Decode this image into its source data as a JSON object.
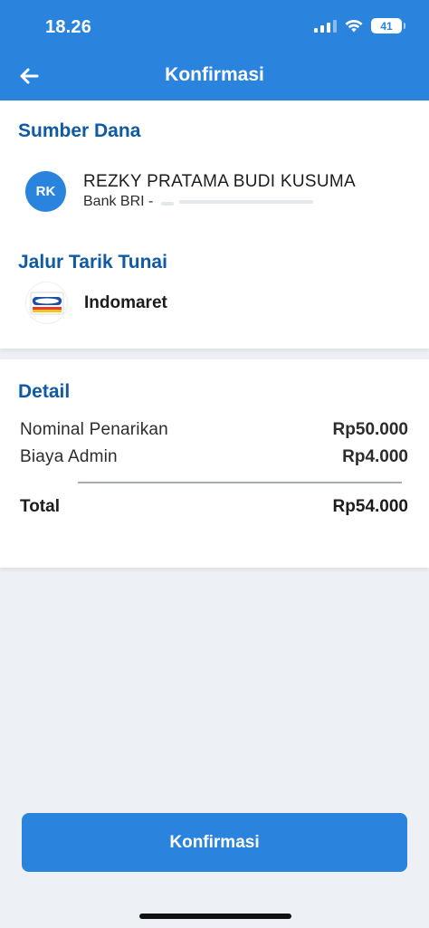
{
  "status_bar": {
    "time": "18.26",
    "battery": "41",
    "icons": [
      "cellular-signal-icon",
      "wifi-icon",
      "battery-icon"
    ]
  },
  "nav": {
    "title": "Konfirmasi",
    "back_icon": "arrow-left-icon"
  },
  "source": {
    "title": "Sumber Dana",
    "avatar_initials": "RK",
    "account_name": "REZKY PRATAMA BUDI KUSUMA",
    "account_bank": "Bank BRI - "
  },
  "channel": {
    "title": "Jalur Tarik Tunai",
    "logo": "indomaret-logo",
    "name": "Indomaret"
  },
  "detail": {
    "title": "Detail",
    "rows": [
      {
        "label": "Nominal Penarikan",
        "value": "Rp50.000"
      },
      {
        "label": "Biaya Admin",
        "value": "Rp4.000"
      }
    ],
    "total_label": "Total",
    "total_value": "Rp54.000"
  },
  "confirm_button": {
    "label": "Konfirmasi"
  },
  "colors": {
    "primary": "#2a84de",
    "section_title": "#0e5aa3",
    "background": "#edf1f5"
  }
}
